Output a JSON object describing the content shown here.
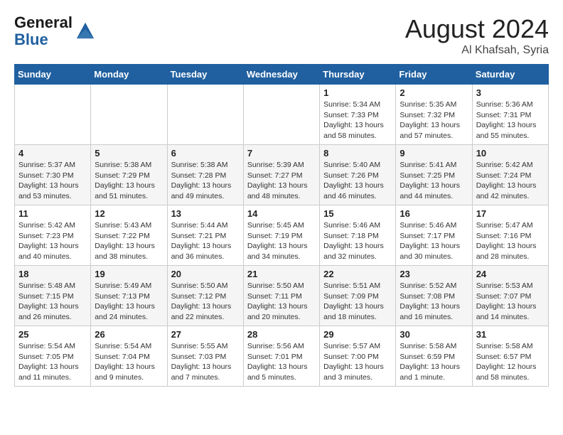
{
  "header": {
    "logo_line1": "General",
    "logo_line2": "Blue",
    "month_year": "August 2024",
    "location": "Al Khafsah, Syria"
  },
  "weekdays": [
    "Sunday",
    "Monday",
    "Tuesday",
    "Wednesday",
    "Thursday",
    "Friday",
    "Saturday"
  ],
  "weeks": [
    [
      {
        "day": "",
        "info": ""
      },
      {
        "day": "",
        "info": ""
      },
      {
        "day": "",
        "info": ""
      },
      {
        "day": "",
        "info": ""
      },
      {
        "day": "1",
        "info": "Sunrise: 5:34 AM\nSunset: 7:33 PM\nDaylight: 13 hours\nand 58 minutes."
      },
      {
        "day": "2",
        "info": "Sunrise: 5:35 AM\nSunset: 7:32 PM\nDaylight: 13 hours\nand 57 minutes."
      },
      {
        "day": "3",
        "info": "Sunrise: 5:36 AM\nSunset: 7:31 PM\nDaylight: 13 hours\nand 55 minutes."
      }
    ],
    [
      {
        "day": "4",
        "info": "Sunrise: 5:37 AM\nSunset: 7:30 PM\nDaylight: 13 hours\nand 53 minutes."
      },
      {
        "day": "5",
        "info": "Sunrise: 5:38 AM\nSunset: 7:29 PM\nDaylight: 13 hours\nand 51 minutes."
      },
      {
        "day": "6",
        "info": "Sunrise: 5:38 AM\nSunset: 7:28 PM\nDaylight: 13 hours\nand 49 minutes."
      },
      {
        "day": "7",
        "info": "Sunrise: 5:39 AM\nSunset: 7:27 PM\nDaylight: 13 hours\nand 48 minutes."
      },
      {
        "day": "8",
        "info": "Sunrise: 5:40 AM\nSunset: 7:26 PM\nDaylight: 13 hours\nand 46 minutes."
      },
      {
        "day": "9",
        "info": "Sunrise: 5:41 AM\nSunset: 7:25 PM\nDaylight: 13 hours\nand 44 minutes."
      },
      {
        "day": "10",
        "info": "Sunrise: 5:42 AM\nSunset: 7:24 PM\nDaylight: 13 hours\nand 42 minutes."
      }
    ],
    [
      {
        "day": "11",
        "info": "Sunrise: 5:42 AM\nSunset: 7:23 PM\nDaylight: 13 hours\nand 40 minutes."
      },
      {
        "day": "12",
        "info": "Sunrise: 5:43 AM\nSunset: 7:22 PM\nDaylight: 13 hours\nand 38 minutes."
      },
      {
        "day": "13",
        "info": "Sunrise: 5:44 AM\nSunset: 7:21 PM\nDaylight: 13 hours\nand 36 minutes."
      },
      {
        "day": "14",
        "info": "Sunrise: 5:45 AM\nSunset: 7:19 PM\nDaylight: 13 hours\nand 34 minutes."
      },
      {
        "day": "15",
        "info": "Sunrise: 5:46 AM\nSunset: 7:18 PM\nDaylight: 13 hours\nand 32 minutes."
      },
      {
        "day": "16",
        "info": "Sunrise: 5:46 AM\nSunset: 7:17 PM\nDaylight: 13 hours\nand 30 minutes."
      },
      {
        "day": "17",
        "info": "Sunrise: 5:47 AM\nSunset: 7:16 PM\nDaylight: 13 hours\nand 28 minutes."
      }
    ],
    [
      {
        "day": "18",
        "info": "Sunrise: 5:48 AM\nSunset: 7:15 PM\nDaylight: 13 hours\nand 26 minutes."
      },
      {
        "day": "19",
        "info": "Sunrise: 5:49 AM\nSunset: 7:13 PM\nDaylight: 13 hours\nand 24 minutes."
      },
      {
        "day": "20",
        "info": "Sunrise: 5:50 AM\nSunset: 7:12 PM\nDaylight: 13 hours\nand 22 minutes."
      },
      {
        "day": "21",
        "info": "Sunrise: 5:50 AM\nSunset: 7:11 PM\nDaylight: 13 hours\nand 20 minutes."
      },
      {
        "day": "22",
        "info": "Sunrise: 5:51 AM\nSunset: 7:09 PM\nDaylight: 13 hours\nand 18 minutes."
      },
      {
        "day": "23",
        "info": "Sunrise: 5:52 AM\nSunset: 7:08 PM\nDaylight: 13 hours\nand 16 minutes."
      },
      {
        "day": "24",
        "info": "Sunrise: 5:53 AM\nSunset: 7:07 PM\nDaylight: 13 hours\nand 14 minutes."
      }
    ],
    [
      {
        "day": "25",
        "info": "Sunrise: 5:54 AM\nSunset: 7:05 PM\nDaylight: 13 hours\nand 11 minutes."
      },
      {
        "day": "26",
        "info": "Sunrise: 5:54 AM\nSunset: 7:04 PM\nDaylight: 13 hours\nand 9 minutes."
      },
      {
        "day": "27",
        "info": "Sunrise: 5:55 AM\nSunset: 7:03 PM\nDaylight: 13 hours\nand 7 minutes."
      },
      {
        "day": "28",
        "info": "Sunrise: 5:56 AM\nSunset: 7:01 PM\nDaylight: 13 hours\nand 5 minutes."
      },
      {
        "day": "29",
        "info": "Sunrise: 5:57 AM\nSunset: 7:00 PM\nDaylight: 13 hours\nand 3 minutes."
      },
      {
        "day": "30",
        "info": "Sunrise: 5:58 AM\nSunset: 6:59 PM\nDaylight: 13 hours\nand 1 minute."
      },
      {
        "day": "31",
        "info": "Sunrise: 5:58 AM\nSunset: 6:57 PM\nDaylight: 12 hours\nand 58 minutes."
      }
    ]
  ]
}
